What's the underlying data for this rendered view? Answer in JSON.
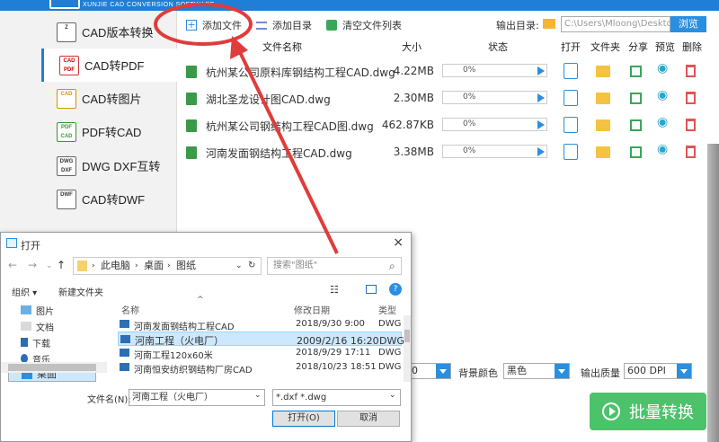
{
  "app": {
    "brand": "XUNJIE CAD CONVERSION SOFTWARE"
  },
  "sidebar": {
    "items": [
      {
        "label": "CAD版本转换",
        "icon": "version-icon"
      },
      {
        "label": "CAD转PDF",
        "icon": "pdf-icon"
      },
      {
        "label": "CAD转图片",
        "icon": "image-icon"
      },
      {
        "label": "PDF转CAD",
        "icon": "pdf-to-cad-icon"
      },
      {
        "label": "DWG DXF互转",
        "icon": "dwg-dxf-icon"
      },
      {
        "label": "CAD转DWF",
        "icon": "dwf-icon"
      }
    ]
  },
  "toolbar": {
    "add_file": "添加文件",
    "add_dir": "添加目录",
    "clear_list": "清空文件列表",
    "output_label": "输出目录:",
    "output_path": "C:\\Users\\Mloong\\Desktop",
    "browse": "浏览"
  },
  "table": {
    "headers": {
      "name": "文件名称",
      "size": "大小",
      "status": "状态",
      "open": "打开",
      "folder": "文件夹",
      "share": "分享",
      "preview": "预览",
      "delete": "删除"
    },
    "rows": [
      {
        "name": "杭州某公司原料库钢结构工程CAD.dwg",
        "size": "4.22MB",
        "progress": "0%",
        "fraction": 0
      },
      {
        "name": "湖北圣龙设计图CAD.dwg",
        "size": "2.30MB",
        "progress": "0%",
        "fraction": 0
      },
      {
        "name": "杭州某公司钢结构工程CAD图.dwg",
        "size": "462.87KB",
        "progress": "0%",
        "fraction": 0
      },
      {
        "name": "河南发面钢结构工程CAD.dwg",
        "size": "3.38MB",
        "progress": "0%",
        "fraction": 0
      }
    ]
  },
  "settings": {
    "bg_label": "背景颜色",
    "bg_value": "黑色",
    "quality_label": "输出质量",
    "quality_value": "600 DPI",
    "partial_value": "0"
  },
  "convert_button": "批量转换",
  "dialog": {
    "title": "打开",
    "close": "×",
    "address": [
      "此电脑",
      "桌面",
      "图纸"
    ],
    "search_placeholder": "搜索\"图纸\"",
    "organize": "组织 ▾",
    "new_folder": "新建文件夹",
    "tree": [
      "图片",
      "文档",
      "下载",
      "音乐",
      "桌面"
    ],
    "columns": {
      "name": "名称",
      "modified": "修改日期",
      "type": "类型"
    },
    "files": [
      {
        "name": "河南发面钢结构工程CAD",
        "date": "2018/9/30 9:00",
        "type": "DWG"
      },
      {
        "name": "河南工程（火电厂）",
        "date": "2009/2/16 16:20",
        "type": "DWG"
      },
      {
        "name": "河南工程120x60米",
        "date": "2018/9/29 17:11",
        "type": "DWG"
      },
      {
        "name": "河南恒安纺织钢结构厂房CAD",
        "date": "2018/10/23 18:51",
        "type": "DWG"
      }
    ],
    "filename_label": "文件名(N):",
    "filename_value": "河南工程（火电厂）",
    "filetype_value": "*.dxf *.dwg",
    "open_btn": "打开(O)",
    "cancel_btn": "取消"
  },
  "colors": {
    "accent": "#1f7fd6",
    "convert": "#4cc26b",
    "annotation": "#e03c3c"
  }
}
